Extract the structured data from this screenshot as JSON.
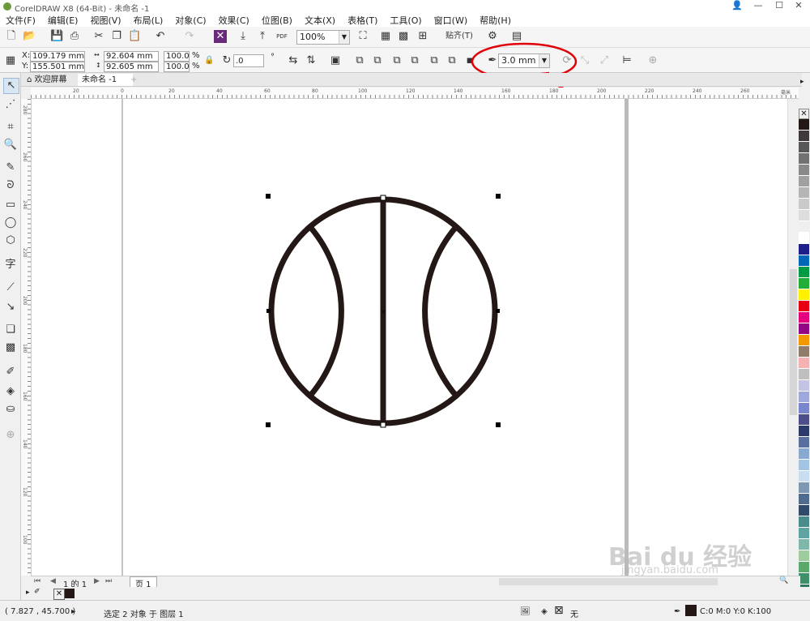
{
  "titlebar": {
    "title": "CorelDRAW X8 (64-Bit) - 未命名 -1"
  },
  "menus": [
    "文件(F)",
    "编辑(E)",
    "视图(V)",
    "布局(L)",
    "对象(C)",
    "效果(C)",
    "位图(B)",
    "文本(X)",
    "表格(T)",
    "工具(O)",
    "窗口(W)",
    "帮助(H)"
  ],
  "toolbar": {
    "zoom": "100%",
    "snap_label": "贴齐(T)",
    "pdf_label": "PDF"
  },
  "propbar": {
    "x_label": "X:",
    "x_value": "109.179 mm",
    "y_label": "Y:",
    "y_value": "155.501 mm",
    "w_value": "92.604 mm",
    "h_value": "92.605 mm",
    "scale_w": "100.0",
    "scale_h": "100.0",
    "percent": "%",
    "rotation": ".0",
    "degree": "°",
    "outline_width": "3.0 mm"
  },
  "tabs": {
    "welcome": "欢迎屏幕",
    "document": "未命名 -1",
    "add": "+"
  },
  "ruler_h": [
    "20",
    "0",
    "20",
    "40",
    "60",
    "80",
    "100",
    "120",
    "140",
    "160",
    "180",
    "200",
    "220",
    "240",
    "260",
    "毫米"
  ],
  "ruler_v": [
    "280",
    "260",
    "240",
    "220",
    "200",
    "180",
    "160",
    "140",
    "120",
    "100",
    "80",
    "60",
    "40",
    "20"
  ],
  "pagenav": {
    "page_info": "1 的 1",
    "page_tab": "页 1"
  },
  "status": {
    "coords": "( 7.827 , 45.700 )",
    "selection": "选定 2 对象 于 图层 1",
    "fill": "无",
    "color_values": "C:0 M:0 Y:0 K:100"
  },
  "watermark": {
    "brand": "Bai du 经验",
    "url": "jingyan.baidu.com"
  },
  "palette": [
    "#ffffff",
    "#231815",
    "#3e3a39",
    "#595757",
    "#727171",
    "#898989",
    "#9fa0a0",
    "#b5b5b6",
    "#c9caca",
    "#dcdddd",
    "#efefef",
    "#ffffff",
    "#1d2088",
    "#0068b7",
    "#009944",
    "#22ac38",
    "#fff100",
    "#e60012",
    "#e4007f",
    "#920783",
    "#f39800",
    "#8f7c6b",
    "#f5b2b2",
    "#bfbfbf",
    "#c3c3e3",
    "#9fa8da",
    "#7986cb",
    "#4b4e8a",
    "#2b3a6b",
    "#5b6f9e",
    "#8aa9d1",
    "#a3c4e3",
    "#c8ddef",
    "#7e97b3",
    "#4f6c8f",
    "#2f4a6b",
    "#4a8c8c",
    "#5fa3a3",
    "#7fb8a8",
    "#9fcc9f",
    "#5aa86a",
    "#3f8f6a",
    "#2f7a5a",
    "#1f6a6a",
    "#3aa0a0"
  ],
  "colors": {
    "accent": "#e0000a",
    "stroke": "#231815"
  }
}
